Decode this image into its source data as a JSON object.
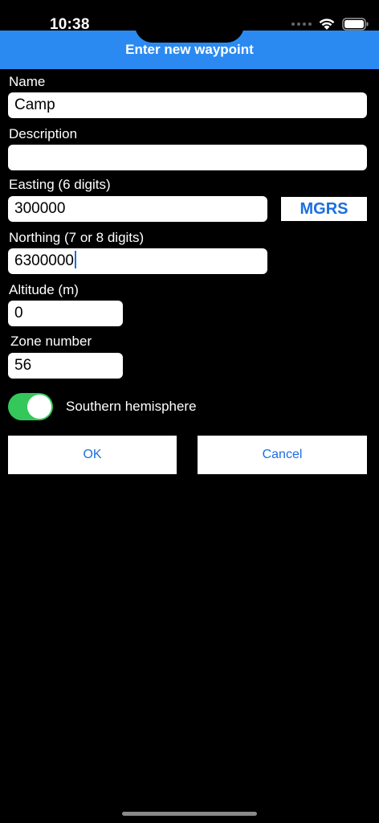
{
  "status": {
    "time": "10:38"
  },
  "header": {
    "title": "Enter new waypoint"
  },
  "form": {
    "name_label": "Name",
    "name_value": "Camp",
    "description_label": "Description",
    "description_value": "",
    "easting_label": "Easting (6 digits)",
    "easting_value": "300000",
    "mgrs_label": "MGRS",
    "northing_label": "Northing (7 or 8 digits)",
    "northing_value": "6300000",
    "altitude_label": "Altitude (m)",
    "altitude_value": "0",
    "zone_label": "Zone number",
    "zone_value": "56",
    "hemisphere_label": "Southern hemisphere",
    "hemisphere_on": true
  },
  "actions": {
    "ok_label": "OK",
    "cancel_label": "Cancel"
  },
  "colors": {
    "header": "#2b8af2",
    "accent": "#1a6fe0",
    "toggle_on": "#34c759"
  },
  "icons": {
    "signal": "signal-icon",
    "wifi": "wifi-icon",
    "battery": "battery-icon"
  }
}
